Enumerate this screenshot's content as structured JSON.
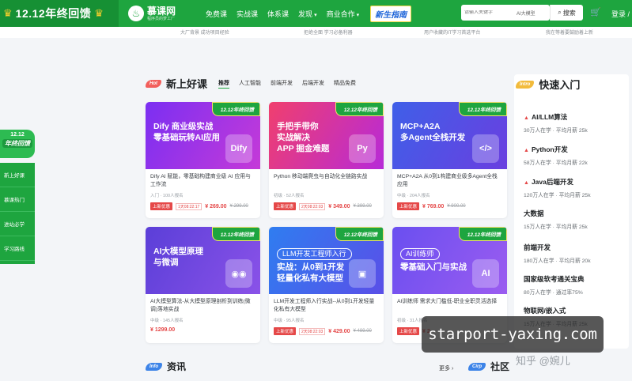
{
  "topbar": {
    "promo": "12.12年终回馈",
    "logo_name": "慕课网",
    "logo_sub": "程序员的梦工厂",
    "nav": [
      "免费课",
      "实战课",
      "体系课",
      "发现",
      "商业合作"
    ],
    "newbie": "新生指南",
    "search_placeholder": "请输入关键字",
    "search_tag": "AI大模型",
    "search_button": "搜索",
    "login": "登录 / 注"
  },
  "strip": [
    "大厂背景 成功项目经验",
    "拒绝全面 学习必备利器",
    "用户收藏的IT学习首选平台",
    "我在等着要鼓励着上新"
  ],
  "side": {
    "badge_year": "12.12",
    "badge_text": "年终回馈",
    "menu": [
      "新上好课",
      "慕课热门",
      "进站必学",
      "学习路线"
    ]
  },
  "new_courses": {
    "tag": "Hot",
    "title": "新上好课",
    "tabs": [
      "推荐",
      "人工智能",
      "前端开发",
      "后端开发",
      "精品免费"
    ],
    "ribbon": "12.12年终回馈",
    "cards": [
      {
        "banner": "Dify 商业级实战\n零基础玩转AI应用",
        "pill": "",
        "art": "Dify",
        "color1": "#7b2ff2",
        "color2": "#c53ad8",
        "desc": "Dify AI 赋能，零基础构建商业级 AI 应用与工作流",
        "meta": "入门 · 100人报名",
        "badge": "上新优惠",
        "countdown": "1天08:22:17",
        "price": "¥ 269.00",
        "old": "¥ 299.00"
      },
      {
        "banner": "手把手带你\n实战解决\nAPP 掘金难题",
        "pill": "",
        "art": "Py",
        "color1": "#f03f6e",
        "color2": "#b72ad8",
        "desc": "Python 移动端爬虫与自动化全链路实战",
        "meta": "初级 · 52人报名",
        "badge": "上新优惠",
        "countdown": "2天08:22:03",
        "price": "¥ 349.00",
        "old": "¥ 399.00"
      },
      {
        "banner": "MCP+A2A\n多Agent全栈开发",
        "pill": "",
        "art": "</>",
        "color1": "#3f5fe8",
        "color2": "#6a3fe0",
        "desc": "MCP+A2A 从0到1构建商业级多Agent全栈应用",
        "meta": "中级 · 204人报名",
        "badge": "上新优惠",
        "countdown": "",
        "price": "¥ 769.00",
        "old": "¥ 900.00"
      },
      {
        "banner": "AI大模型原理\n与微调",
        "pill": "",
        "art": "◉◉",
        "color1": "#5b3fd8",
        "color2": "#8a52e8",
        "desc": "AI大模型算法-从大模型原理剖析到训练(微调)落地实战",
        "meta": "中级 · 145人报名",
        "badge": "",
        "countdown": "",
        "price": "¥ 1299.00",
        "old": ""
      },
      {
        "banner": "实战：从0到1开发\n轻量化私有大模型",
        "pill": "LLM开发工程师入行",
        "art": "▣",
        "color1": "#2f7df0",
        "color2": "#5a4fe8",
        "desc": "LLM开发工程师入行实战--从0到1开发轻量化私有大模型",
        "meta": "中级 · 95人报名",
        "badge": "上新优惠",
        "countdown": "2天08:22:03",
        "price": "¥ 429.00",
        "old": "¥ 499.00"
      },
      {
        "banner": "零基础入门与实战",
        "pill": "AI训练师",
        "art": "AI",
        "color1": "#6a4ff0",
        "color2": "#9b5cf0",
        "desc": "AI训练师 需求大门槛低-职业全职灵活选择",
        "meta": "初级 · 31人报名",
        "badge": "上新优惠",
        "countdown": "",
        "price": "¥ 2",
        "old": ""
      }
    ]
  },
  "quick_start": {
    "tag": "Intro",
    "title": "快速入门",
    "items": [
      {
        "name": "AI/LLM算法",
        "hot": true,
        "stat": "30万人在学 · 平均月薪 25k"
      },
      {
        "name": "Python开发",
        "hot": true,
        "stat": "58万人在学 · 平均月薪 22k"
      },
      {
        "name": "Java后端开发",
        "hot": true,
        "stat": "120万人在学 · 平均月薪 25k"
      },
      {
        "name": "大数据",
        "hot": false,
        "stat": "15万人在学 · 平均月薪 25k"
      },
      {
        "name": "前端开发",
        "hot": false,
        "stat": "180万人在学 · 平均月薪 20k"
      },
      {
        "name": "国家级软考通关宝典",
        "hot": false,
        "stat": "80万人在学 · 通过率75%"
      },
      {
        "name": "物联网/嵌入式",
        "hot": false,
        "stat": "15万人在学 · 平均月薪 25k"
      }
    ]
  },
  "news": {
    "tag": "Info",
    "title": "资讯",
    "more": "更多 ›"
  },
  "community": {
    "tag": "Cirp",
    "title": "社区"
  },
  "watermark": "starport-yaxing.com",
  "zhihu": "知乎 @婉儿"
}
